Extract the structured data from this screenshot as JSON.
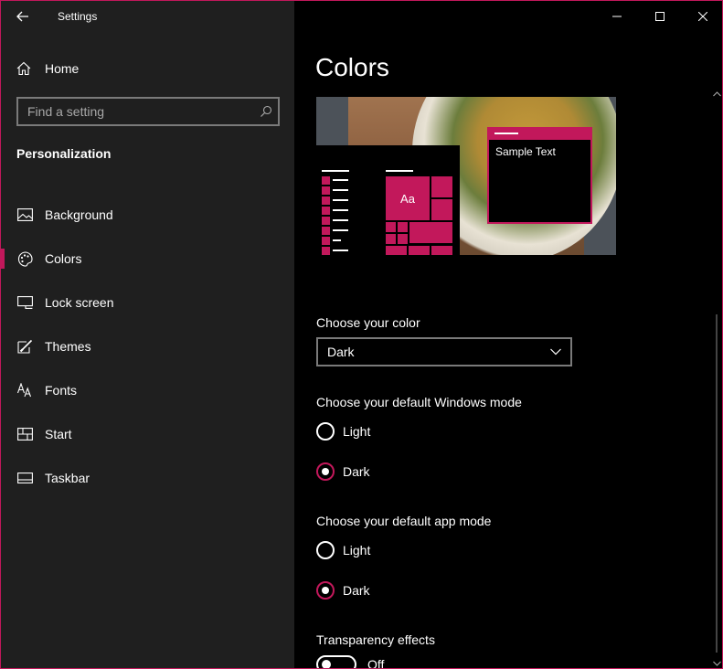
{
  "app": {
    "title": "Settings",
    "back_icon": "back-arrow-icon",
    "accent_color": "#c2185b",
    "sidebar_bg": "#1f1f1f",
    "main_bg": "#000000"
  },
  "sidebar": {
    "home_label": "Home",
    "search_placeholder": "Find a setting",
    "section_title": "Personalization",
    "items": [
      {
        "label": "Background",
        "icon": "picture-icon"
      },
      {
        "label": "Colors",
        "icon": "palette-icon",
        "selected": true
      },
      {
        "label": "Lock screen",
        "icon": "lock-screen-icon"
      },
      {
        "label": "Themes",
        "icon": "themes-brush-icon"
      },
      {
        "label": "Fonts",
        "icon": "fonts-icon"
      },
      {
        "label": "Start",
        "icon": "start-icon"
      },
      {
        "label": "Taskbar",
        "icon": "taskbar-icon"
      }
    ]
  },
  "main": {
    "title": "Colors",
    "preview": {
      "sample_text": "Sample Text",
      "tile_text": "Aa"
    },
    "choose_color": {
      "label": "Choose your color",
      "value": "Dark"
    },
    "windows_mode": {
      "label": "Choose your default Windows mode",
      "options": [
        "Light",
        "Dark"
      ],
      "selected": "Dark"
    },
    "app_mode": {
      "label": "Choose your default app mode",
      "options": [
        "Light",
        "Dark"
      ],
      "selected": "Dark"
    },
    "transparency": {
      "label": "Transparency effects",
      "state": "Off"
    }
  }
}
